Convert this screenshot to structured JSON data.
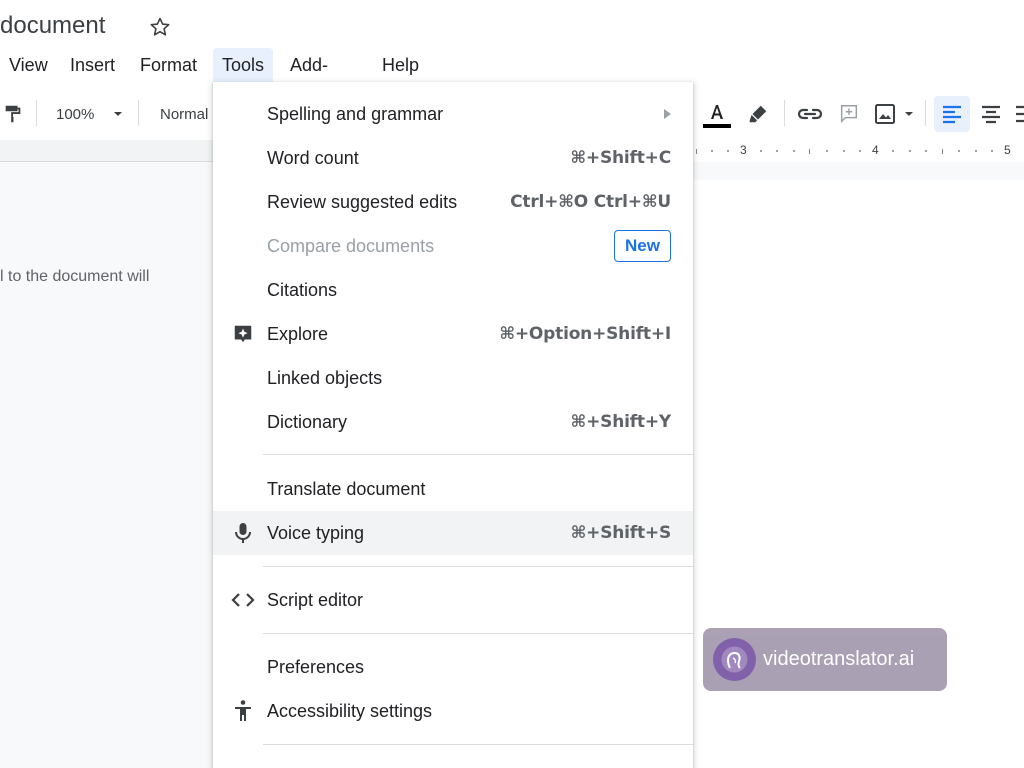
{
  "header": {
    "doc_title": "document",
    "star_icon": "star-outline-icon"
  },
  "menubar": {
    "items": [
      "View",
      "Insert",
      "Format",
      "Tools",
      "Add-ons",
      "Help"
    ],
    "active": "Tools"
  },
  "toolbar": {
    "zoom": "100%",
    "style": "Normal",
    "text_color": "#000000",
    "icons": [
      "paint-format-icon",
      "chevron-down-icon",
      "text-color-icon",
      "highlighter-icon",
      "link-icon",
      "add-comment-icon",
      "insert-image-icon",
      "align-left-icon",
      "align-center-icon"
    ]
  },
  "ruler": {
    "numbers": [
      "3",
      "4",
      "5"
    ]
  },
  "document": {
    "body_fragment": "l to the document will"
  },
  "tools_menu": {
    "spelling": {
      "label": "Spelling and grammar"
    },
    "word_count": {
      "label": "Word count",
      "shortcut": "⌘+Shift+C"
    },
    "review": {
      "label": "Review suggested edits",
      "shortcut": "Ctrl+⌘O Ctrl+⌘U"
    },
    "compare": {
      "label": "Compare documents",
      "badge": "New"
    },
    "citations": {
      "label": "Citations"
    },
    "explore": {
      "label": "Explore",
      "shortcut": "⌘+Option+Shift+I"
    },
    "linked": {
      "label": "Linked objects"
    },
    "dictionary": {
      "label": "Dictionary",
      "shortcut": "⌘+Shift+Y"
    },
    "translate": {
      "label": "Translate document"
    },
    "voice": {
      "label": "Voice typing",
      "shortcut": "⌘+Shift+S"
    },
    "script": {
      "label": "Script editor"
    },
    "preferences": {
      "label": "Preferences"
    },
    "accessibility": {
      "label": "Accessibility settings"
    }
  },
  "watermark": {
    "text": "videotranslator.ai"
  },
  "colors": {
    "accent": "#1a73e8",
    "menu_active_bg": "#e8f0fe",
    "hover_bg": "#f1f3f4",
    "watermark_bg": "#a69bb0"
  }
}
